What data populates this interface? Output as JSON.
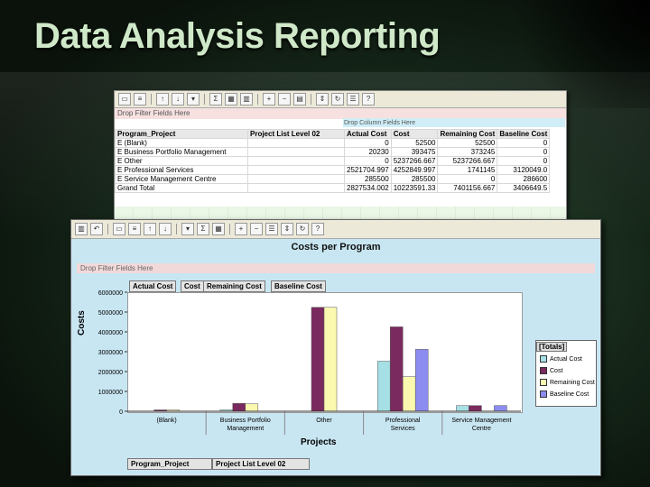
{
  "slide": {
    "title": "Data Analysis Reporting"
  },
  "pivot": {
    "filter_text": "Drop Filter Fields Here",
    "column_drop_text": "Drop Column Fields Here",
    "headers": [
      "Program_Project",
      "Project List Level 02",
      "Actual Cost",
      "Cost",
      "Remaining Cost",
      "Baseline Cost"
    ],
    "rows": [
      [
        "E (Blank)",
        "",
        "0",
        "52500",
        "52500",
        "0"
      ],
      [
        "E Business Portfolio Management",
        "",
        "20230",
        "393475",
        "373245",
        "0"
      ],
      [
        "E Other",
        "",
        "0",
        "5237266.667",
        "5237266.667",
        "0"
      ],
      [
        "E Professional Services",
        "",
        "2521704.997",
        "4252849.997",
        "1741145",
        "3120049.0"
      ],
      [
        "E Service Management Centre",
        "",
        "285500",
        "285500",
        "0",
        "286600"
      ],
      [
        "Grand Total",
        "",
        "2827534.002",
        "10223591.33",
        "7401156.667",
        "3406649.5"
      ]
    ]
  },
  "chart_window": {
    "title": "Costs per Program",
    "filter_text": "Drop Filter Fields Here",
    "data_fields": [
      "Actual Cost",
      "Cost",
      "Remaining Cost",
      "Baseline Cost"
    ],
    "legend_title": "[Totals]",
    "row_fields": [
      "Program_Project",
      "Project List Level 02"
    ]
  },
  "chart_data": {
    "type": "bar",
    "title": "Costs per Program",
    "xlabel": "Projects",
    "ylabel": "Costs",
    "ylim": [
      0,
      6000000
    ],
    "yticks": [
      "0",
      "1000000",
      "2000000",
      "3000000",
      "4000000",
      "5000000",
      "6000000"
    ],
    "categories": [
      "(Blank)",
      "Business Portfolio Management",
      "Other",
      "Professional Services",
      "Service Management Centre"
    ],
    "series": [
      {
        "name": "Actual Cost",
        "color": "#a6e0e6",
        "values": [
          0,
          20230,
          0,
          2521705,
          285500
        ]
      },
      {
        "name": "Cost",
        "color": "#7a2a5e",
        "values": [
          52500,
          393475,
          5237267,
          4252850,
          285500
        ]
      },
      {
        "name": "Remaining Cost",
        "color": "#fbf8b0",
        "values": [
          52500,
          373245,
          5237267,
          1741145,
          0
        ]
      },
      {
        "name": "Baseline Cost",
        "color": "#8c8cf0",
        "values": [
          0,
          0,
          0,
          3120049,
          286600
        ]
      }
    ],
    "grid": false,
    "legend": "right"
  }
}
